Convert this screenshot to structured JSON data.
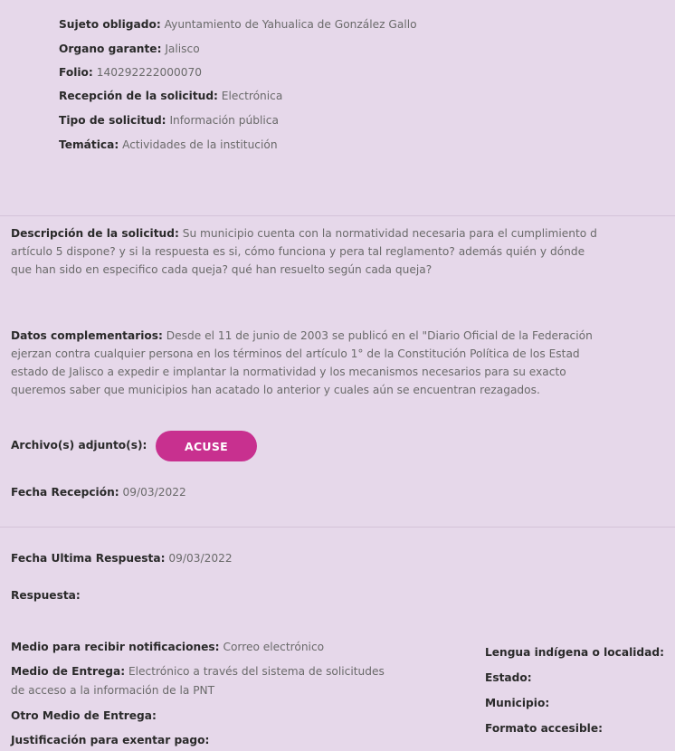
{
  "header": {
    "sujeto": {
      "label": "Sujeto obligado:",
      "value": "Ayuntamiento de Yahualica de González Gallo"
    },
    "organo": {
      "label": "Organo garante:",
      "value": "Jalisco"
    },
    "folio": {
      "label": "Folio:",
      "value": "140292222000070"
    },
    "recepcion": {
      "label": "Recepción de la solicitud:",
      "value": "Electrónica"
    },
    "tipo": {
      "label": "Tipo de solicitud:",
      "value": "Información pública"
    },
    "tematica": {
      "label": "Temática:",
      "value": "Actividades de la institución"
    }
  },
  "descripcion": {
    "label": "Descripción de la solicitud:",
    "line1": "Su municipio cuenta con la normatividad necesaria para el cumplimiento d",
    "line2": "artículo 5 dispone? y si la respuesta es si, cómo funciona y pera tal reglamento? además quién y dónde",
    "line3": "que han sido en especifico cada queja? qué han resuelto según cada queja?"
  },
  "datos": {
    "label": "Datos complementarios:",
    "line1": "Desde el 11 de junio de 2003 se publicó en el \"Diario Oficial de la Federación",
    "line2": "ejerzan contra cualquier persona en los términos del artículo 1° de la Constitución Política de los Estad",
    "line3": "estado de Jalisco a expedir e implantar la normatividad y los mecanismos necesarios para su exacto",
    "line4": "queremos saber que municipios han acatado lo anterior y cuales aún se encuentran rezagados."
  },
  "archivo": {
    "label": "Archivo(s) adjunto(s):",
    "button": "ACUSE"
  },
  "fecha_recepcion": {
    "label": "Fecha Recepción:",
    "value": "09/03/2022"
  },
  "fecha_respuesta": {
    "label": "Fecha Ultima Respuesta:",
    "value": "09/03/2022"
  },
  "respuesta": {
    "label": "Respuesta:"
  },
  "left_fields": {
    "medio_notif": {
      "label": "Medio para recibir notificaciones:",
      "value": "Correo electrónico"
    },
    "medio_entrega": {
      "label": "Medio de Entrega:",
      "value": "Electrónico a través del sistema de solicitudes",
      "value2": "de acceso a la información de la PNT"
    },
    "otro_medio": {
      "label": "Otro Medio de Entrega:"
    },
    "justificacion": {
      "label": "Justificación para exentar pago:"
    }
  },
  "right_fields": {
    "lengua": {
      "label": "Lengua indígena o localidad:"
    },
    "estado": {
      "label": "Estado:"
    },
    "municipio": {
      "label": "Municipio:"
    },
    "formato": {
      "label": "Formato accesible:"
    }
  }
}
